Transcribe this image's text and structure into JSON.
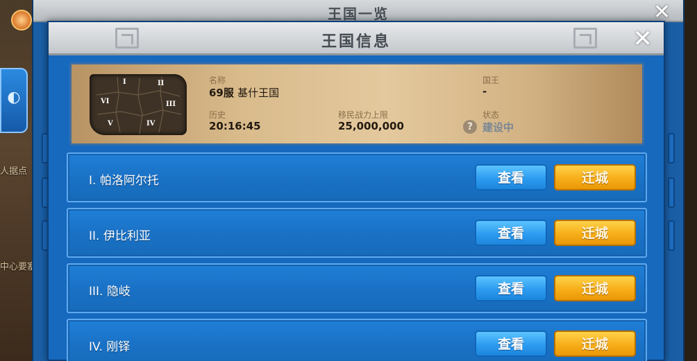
{
  "background": {
    "left_texts": [
      "人据点",
      "中心要塞"
    ]
  },
  "back_panel": {
    "title": "王国一览"
  },
  "kingdom_info": {
    "title": "王国信息",
    "map_labels": [
      "I",
      "II",
      "III",
      "IV",
      "V",
      "VI"
    ],
    "name_label": "名称",
    "name_server": "69服",
    "name_value": "基什王国",
    "king_label": "国王",
    "king_value": "-",
    "history_label": "历史",
    "history_value": "20:16:45",
    "power_label": "移民战力上限",
    "power_value": "25,000,000",
    "status_label": "状态",
    "status_value": "建设中"
  },
  "provinces": [
    {
      "label": "I. 帕洛阿尔托",
      "view": "查看",
      "move": "迁城"
    },
    {
      "label": "II. 伊比利亚",
      "view": "查看",
      "move": "迁城"
    },
    {
      "label": "III. 隐岐",
      "view": "查看",
      "move": "迁城"
    },
    {
      "label": "IV. 刚铎",
      "view": "查看",
      "move": "迁城"
    }
  ],
  "colors": {
    "panel_blue": "#1769be",
    "view_button": "#2d9cf0",
    "move_button": "#f7ae19",
    "parchment": "#d9bb8c"
  }
}
